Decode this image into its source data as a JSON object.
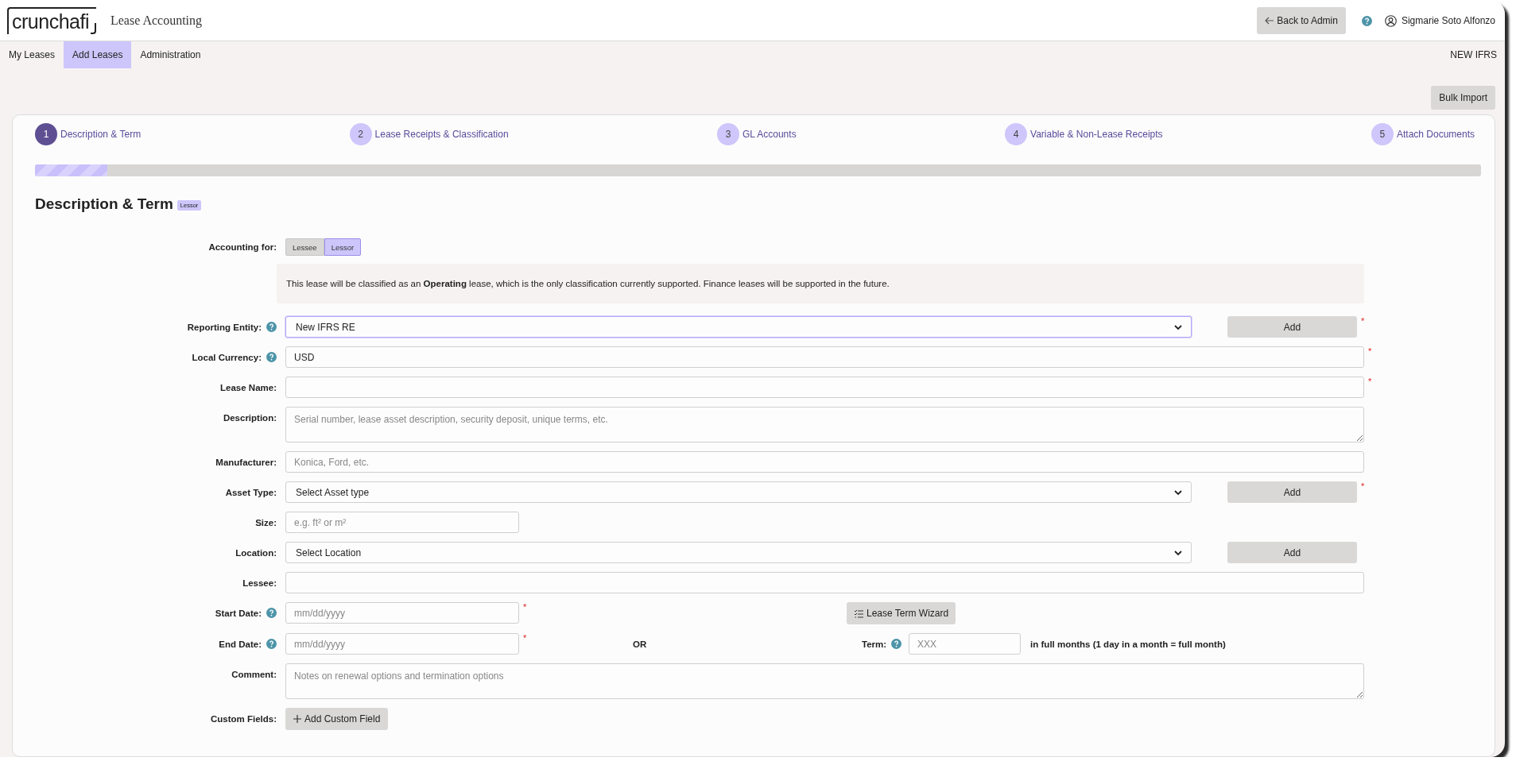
{
  "header": {
    "logo": "crunchafi",
    "app_title": "Lease Accounting",
    "back_button": "Back to Admin",
    "user": "Sigmarie Soto Alfonzo"
  },
  "nav": {
    "tabs": [
      {
        "label": "My Leases",
        "selected": false
      },
      {
        "label": "Add Leases",
        "selected": true
      },
      {
        "label": "Administration",
        "selected": false
      }
    ],
    "entity": "NEW IFRS"
  },
  "bulk_import": "Bulk Import",
  "steps": [
    {
      "number": "1",
      "label": "Description & Term",
      "selected": true
    },
    {
      "number": "2",
      "label": "Lease Receipts & Classification",
      "selected": false
    },
    {
      "number": "3",
      "label": "GL Accounts",
      "selected": false
    },
    {
      "number": "4",
      "label": "Variable & Non-Lease Receipts",
      "selected": false
    },
    {
      "number": "5",
      "label": "Attach Documents",
      "selected": false
    }
  ],
  "progress": {
    "level": 0.05
  },
  "section": {
    "title": "Description & Term",
    "badge": "Lessor"
  },
  "accounting_for": {
    "label": "Accounting for:",
    "options": [
      {
        "label": "Lessee",
        "selected": false
      },
      {
        "label": "Lessor",
        "selected": true
      }
    ]
  },
  "notice": "This lease will be classified as an **Operating** lease, which is the only classification currently supported. Finance leases will be supported in the future.",
  "fields": [
    {
      "kind": "select",
      "label": "Reporting Entity:",
      "help": true,
      "value": "New IFRS RE",
      "focused": true,
      "button": "Add",
      "required": "*"
    },
    {
      "kind": "text",
      "label": "Local Currency:",
      "help": true,
      "value": "USD",
      "required": "*"
    },
    {
      "kind": "text",
      "label": "Lease Name:",
      "help": false,
      "required": "*"
    },
    {
      "kind": "textarea",
      "label": "Description:",
      "help": false,
      "placeholder": "Serial number, lease asset description, security deposit, unique terms, etc."
    },
    {
      "kind": "text",
      "label": "Manufacturer:",
      "help": false,
      "placeholder": "Konica, Ford, etc."
    },
    {
      "kind": "select",
      "label": "Asset Type:",
      "help": false,
      "value": "Select Asset type",
      "focused": false,
      "button": "Add",
      "required": "*"
    },
    {
      "kind": "short",
      "label": "Size:",
      "help": false,
      "placeholder": "e.g. ft² or m²"
    },
    {
      "kind": "select",
      "label": "Location:",
      "help": false,
      "value": "Select Location",
      "focused": false,
      "button": "Add"
    },
    {
      "kind": "text",
      "label": "Lessee:",
      "help": false
    },
    {
      "kind": "date",
      "label": "Start Date:",
      "help": true,
      "placeholder": "mm/dd/yyyy",
      "required": "*",
      "wizard": "Lease Term Wizard"
    },
    {
      "kind": "date",
      "label": "End Date:",
      "help": true,
      "placeholder": "mm/dd/yyyy",
      "required": "*",
      "or": "OR",
      "term": {
        "label": "Term:",
        "help": true,
        "placeholder": "XXX",
        "note": "in full months (1 day in a month = full month)"
      }
    },
    {
      "kind": "textarea",
      "label": "Comment:",
      "help": false,
      "placeholder": "Notes on renewal options and termination options"
    },
    {
      "kind": "action",
      "label": "Custom Fields:",
      "help": false,
      "button": "Add Custom Field"
    }
  ]
}
